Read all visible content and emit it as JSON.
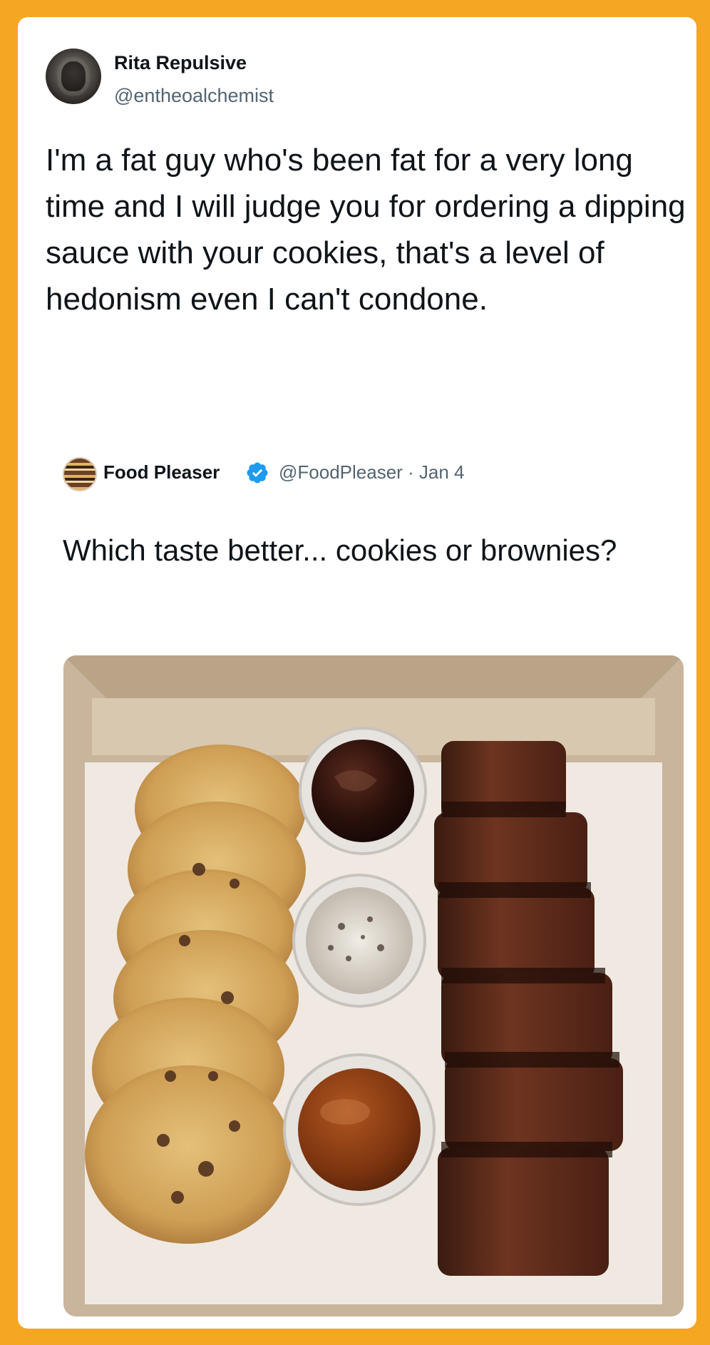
{
  "author": {
    "name": "Rita Repulsive",
    "handle": "@entheoalchemist"
  },
  "tweet": {
    "text": "I'm a fat guy who's been fat for a very long time and I will judge you for ordering a dipping sauce with your cookies, that's a level of hedonism even I can't condone."
  },
  "quoted": {
    "name": "Food Pleaser",
    "handle_date": "@FoodPleaser · Jan 4",
    "text": "Which taste better... cookies or brownies?",
    "verified_color": "#1d9bf0"
  },
  "colors": {
    "frame": "#F5A623",
    "handle_gray": "#536471"
  },
  "icons": [
    "avatar",
    "verified-badge-icon",
    "food-photo"
  ]
}
